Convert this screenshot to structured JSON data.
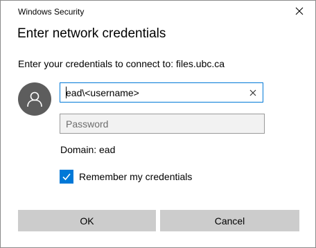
{
  "window": {
    "title": "Windows Security",
    "close_icon": "close-icon"
  },
  "dialog": {
    "heading": "Enter network credentials",
    "prompt": "Enter your credentials to connect to: files.ubc.ca",
    "avatar_icon": "user-icon",
    "username": {
      "value": "ead\\<username>",
      "clear_icon": "clear-x-icon"
    },
    "password": {
      "value": "",
      "placeholder": "Password"
    },
    "domain_text": "Domain: ead",
    "remember": {
      "checked": true,
      "label": "Remember my credentials"
    },
    "buttons": {
      "ok_label": "OK",
      "cancel_label": "Cancel"
    }
  },
  "colors": {
    "accent": "#0078d7",
    "button_bg": "#cccccc",
    "avatar_bg": "#5d5d5d"
  }
}
